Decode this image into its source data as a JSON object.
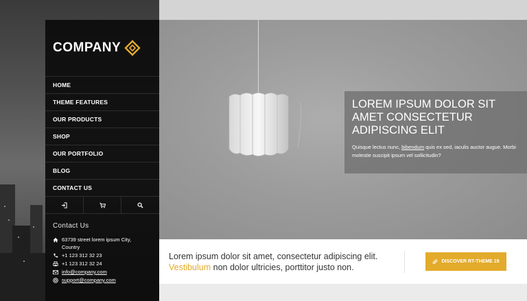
{
  "brand": {
    "name": "COMPANY",
    "accent": "#e3ab2b"
  },
  "nav": {
    "items": [
      {
        "label": "HOME"
      },
      {
        "label": "THEME FEATURES"
      },
      {
        "label": "OUR PRODUCTS"
      },
      {
        "label": "SHOP"
      },
      {
        "label": "OUR PORTFOLIO"
      },
      {
        "label": "BLOG"
      },
      {
        "label": "CONTACT US"
      }
    ],
    "icons": [
      "login-icon",
      "cart-icon",
      "search-icon"
    ]
  },
  "contact": {
    "title": "Contact Us",
    "address_line1": "63739 street lorem ipsum City,",
    "address_line2": "Country",
    "phone": "+1 123 312 32 23",
    "fax": "+1 123 312 32 24",
    "email": "info@company.com",
    "support": "support@company.com"
  },
  "hero": {
    "title": "LOREM IPSUM DOLOR SIT AMET CONSECTETUR ADIPISCING ELIT",
    "text_before": "Quisque lectus nunc, ",
    "text_link": "bibendum",
    "text_after": " quis ex sed, iaculis auctor augue. Morbi molestie suscipit ipsum vel sollicitudin?"
  },
  "band": {
    "line1": "Lorem ipsum dolor sit amet, consectetur adipiscing elit.",
    "highlight": "Vestibulum",
    "line2_rest": " non dolor ultricies, porttitor justo non.",
    "button_label": "DISCOVER RT-THEME 19"
  }
}
